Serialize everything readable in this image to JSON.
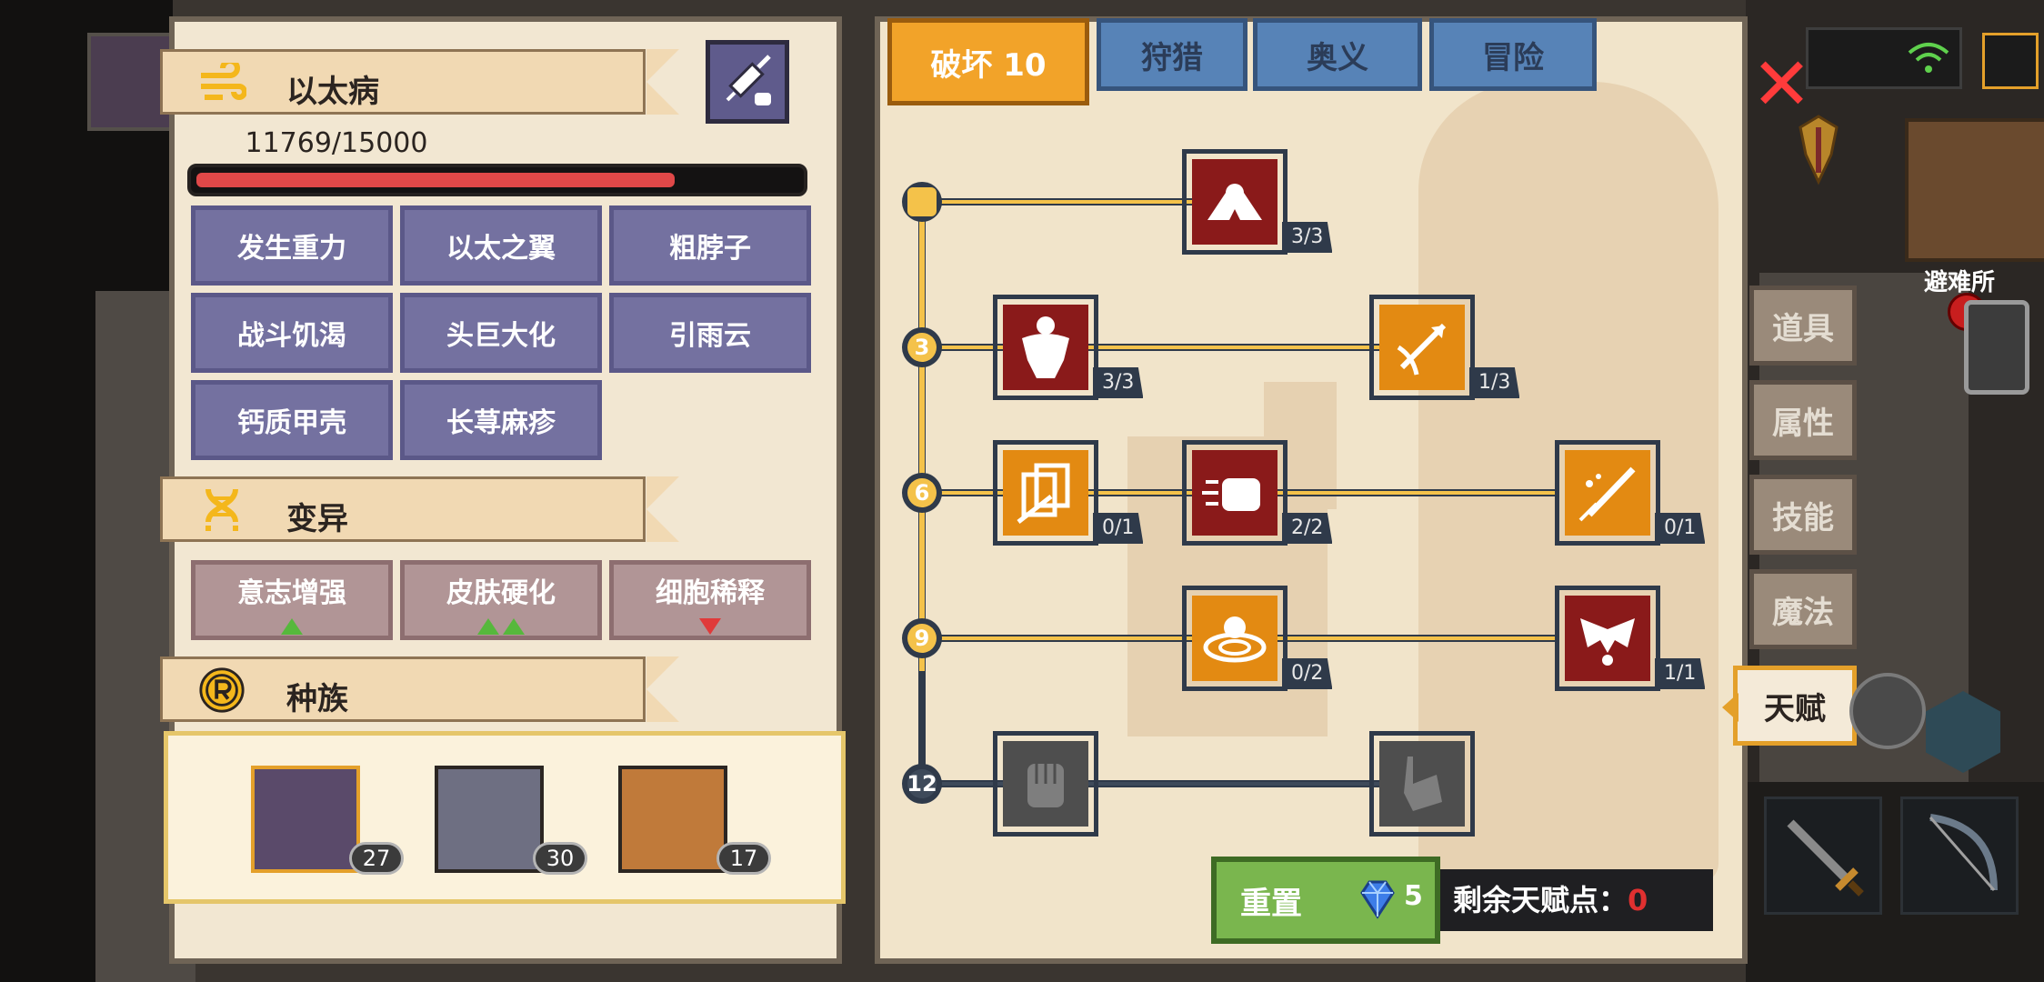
{
  "disease": {
    "title": "以太病",
    "hp_text": "11769/15000",
    "hp_fraction": 0.7846,
    "symptoms": [
      "发生重力",
      "以太之翼",
      "粗脖子",
      "战斗饥渴",
      "头巨大化",
      "引雨云",
      "钙质甲壳",
      "长荨麻疹"
    ]
  },
  "mutation": {
    "title": "变异",
    "items": [
      {
        "label": "意志增强",
        "arrows": "up",
        "count": 1
      },
      {
        "label": "皮肤硬化",
        "arrows": "up",
        "count": 2
      },
      {
        "label": "细胞稀释",
        "arrows": "down",
        "count": 1
      }
    ]
  },
  "race": {
    "title": "种族",
    "members": [
      {
        "level": "27",
        "selected": true
      },
      {
        "level": "30",
        "selected": false
      },
      {
        "level": "17",
        "selected": false
      }
    ]
  },
  "talent": {
    "tabs": [
      "破坏 10",
      "狩猎",
      "奥义",
      "冒险"
    ],
    "active_tab": 0,
    "tiers": [
      "3",
      "6",
      "9",
      "12"
    ],
    "skills": [
      {
        "name": "arm-wrestle-icon",
        "count": "3/3"
      },
      {
        "name": "muscle-body-icon",
        "count": "3/3"
      },
      {
        "name": "arrow-strike-icon",
        "count": "1/3"
      },
      {
        "name": "card-slash-icon",
        "count": "0/1"
      },
      {
        "name": "punch-icon",
        "count": "2/2"
      },
      {
        "name": "sword-splash-icon",
        "count": "0/1"
      },
      {
        "name": "shockwave-icon",
        "count": "0/2"
      },
      {
        "name": "bat-wings-icon",
        "count": "1/1"
      },
      {
        "name": "fist-icon"
      },
      {
        "name": "gauntlet-icon"
      }
    ],
    "reset_label": "重置",
    "reset_cost": "5",
    "remaining_label": "剩余天赋点：",
    "remaining_value": "0"
  },
  "side_tabs": [
    "道具",
    "属性",
    "技能",
    "魔法",
    "天赋"
  ],
  "active_side_tab": 4,
  "evac_label": "避难所",
  "colors": {
    "panel_bg": "#f2e7d2",
    "gold_line": "#f4c24a",
    "active_tab": "#f2a329",
    "inactive_tab": "#5783b7",
    "hp_red": "#e04848",
    "reset_green": "#7ab64e"
  }
}
